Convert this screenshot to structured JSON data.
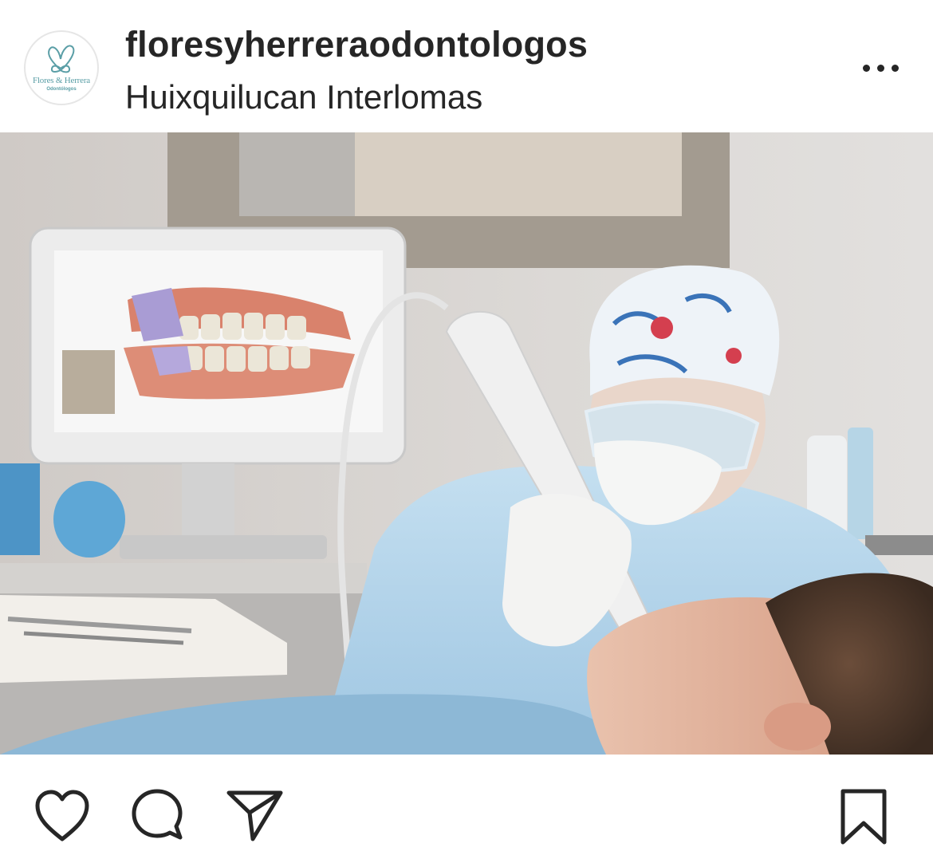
{
  "post": {
    "username": "floresyherreraodontologos",
    "location": "Huixquilucan Interlomas",
    "avatar": {
      "brand_name": "Flores & Herrera",
      "brand_tagline": "Odontólogos",
      "accent_color": "#5a9ea6"
    },
    "more_icon": "more-horizontal-icon",
    "photo_description_icon": "post-photo"
  },
  "actions": {
    "like_icon": "heart-icon",
    "comment_icon": "comment-icon",
    "share_icon": "paper-plane-icon",
    "save_icon": "bookmark-icon"
  },
  "colors": {
    "text": "#262626",
    "background": "#ffffff"
  }
}
